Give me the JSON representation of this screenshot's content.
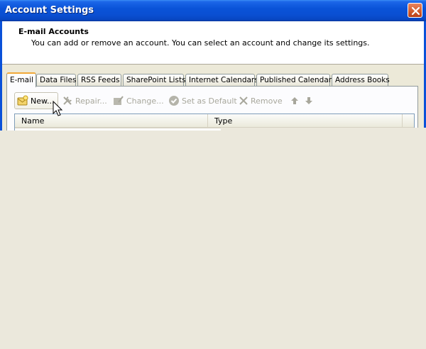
{
  "window": {
    "title": "Account Settings",
    "close_label": ""
  },
  "header": {
    "title": "E-mail Accounts",
    "description": "You can add or remove an account. You can select an account and change its settings."
  },
  "tabs": [
    {
      "label": "E-mail",
      "active": true
    },
    {
      "label": "Data Files"
    },
    {
      "label": "RSS Feeds"
    },
    {
      "label": "SharePoint Lists"
    },
    {
      "label": "Internet Calendars"
    },
    {
      "label": "Published Calendars"
    },
    {
      "label": "Address Books"
    }
  ],
  "toolbar": {
    "new": {
      "label": "New...",
      "icon": "new-account-icon",
      "enabled": true
    },
    "repair": {
      "label": "Repair...",
      "icon": "repair-icon",
      "enabled": false
    },
    "change": {
      "label": "Change...",
      "icon": "change-icon",
      "enabled": false
    },
    "set_default": {
      "label": "Set as Default",
      "icon": "checkmark-icon",
      "enabled": false
    },
    "remove": {
      "label": "Remove",
      "icon": "remove-x-icon",
      "enabled": false
    },
    "move_up": {
      "icon": "arrow-up-icon",
      "enabled": false
    },
    "move_down": {
      "icon": "arrow-down-icon",
      "enabled": false
    }
  },
  "accounts_list": {
    "columns": [
      "Name",
      "Type"
    ],
    "rows": []
  },
  "colors": {
    "titlebar": "#0a51d9",
    "active_tab_accent": "#f1a838",
    "window_background": "#ece9d8"
  }
}
